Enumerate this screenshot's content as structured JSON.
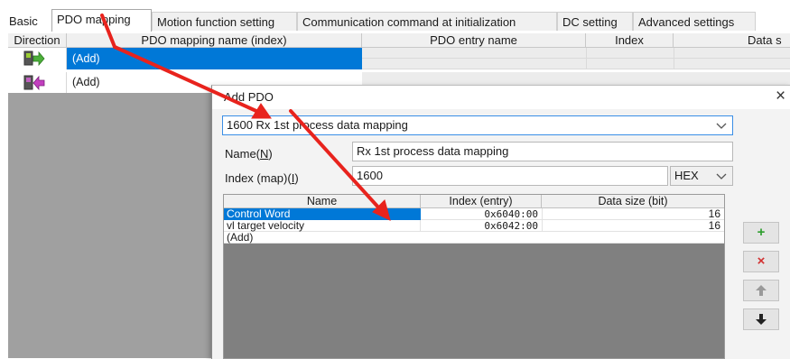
{
  "tabs": [
    {
      "label": "Basic"
    },
    {
      "label": "PDO mapping"
    },
    {
      "label": "Motion function setting"
    },
    {
      "label": "Communication command at initialization"
    },
    {
      "label": "DC setting"
    },
    {
      "label": "Advanced settings"
    }
  ],
  "main_grid": {
    "headers": [
      "Direction",
      "PDO mapping name (index)",
      "PDO entry name",
      "Index",
      "Data s"
    ],
    "rows": [
      {
        "direction_icon": "rx-output-arrow-icon",
        "name": "(Add)",
        "selected": true
      },
      {
        "direction_icon": "tx-input-arrow-icon",
        "name": "(Add)",
        "selected": false
      }
    ]
  },
  "dialog": {
    "title": "Add PDO",
    "close_glyph": "×",
    "pdo_select": "1600 Rx 1st process data mapping",
    "name_label": "Name(N)",
    "name_label_pre": "Name(",
    "name_label_key": "N",
    "name_label_post": ")",
    "name_value": "Rx 1st process data mapping",
    "index_label_pre": "Index (map)(",
    "index_label_key": "I",
    "index_label_post": ")",
    "index_value": "1600",
    "radix": "HEX",
    "entries": {
      "headers": [
        "Name",
        "Index (entry)",
        "Data size (bit)"
      ],
      "rows": [
        {
          "name": "Control Word",
          "index": "0x6040:00",
          "size": "16",
          "selected": true
        },
        {
          "name": "vl target velocity",
          "index": "0x6042:00",
          "size": "16",
          "selected": false
        },
        {
          "name": "(Add)",
          "index": "",
          "size": "",
          "selected": false
        }
      ]
    },
    "side_buttons": [
      {
        "icon": "add-plus-icon",
        "glyph": "+",
        "color": "#2e9e2e"
      },
      {
        "icon": "delete-x-icon",
        "glyph": "×",
        "color": "#d23030"
      },
      {
        "icon": "move-up-arrow-icon",
        "glyph": "🡅",
        "color": "#9a9a9a"
      },
      {
        "icon": "move-down-arrow-icon",
        "glyph": "🡇",
        "color": "#1a1a1a"
      }
    ]
  },
  "colors": {
    "selection": "#0078d7",
    "annotation_arrow": "#e8231d"
  }
}
